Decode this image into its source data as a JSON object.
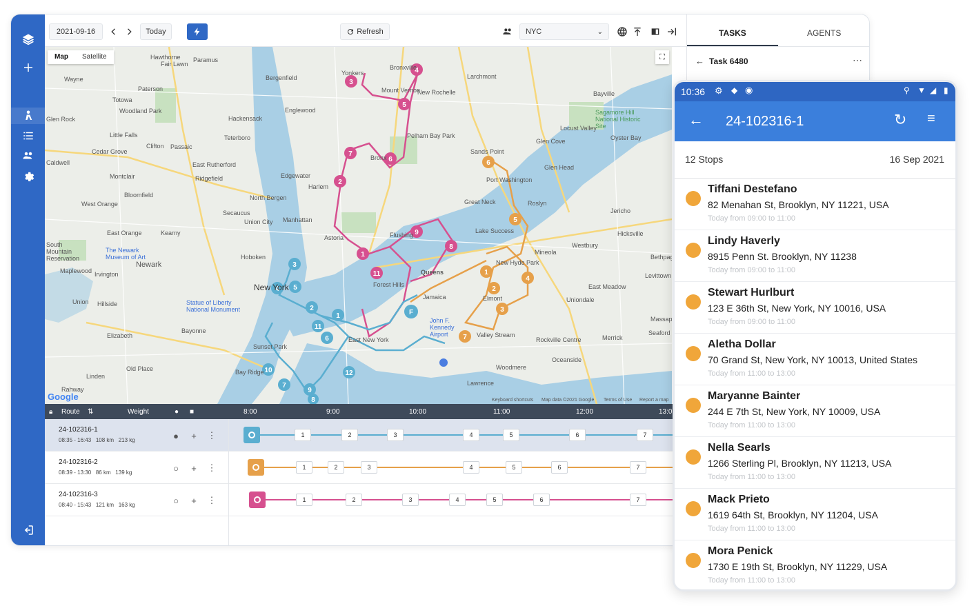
{
  "toolbar": {
    "date": "2021-09-16",
    "today_label": "Today",
    "refresh_label": "Refresh",
    "region": "NYC",
    "accent": "#2f68c5"
  },
  "map": {
    "map_label": "Map",
    "satellite_label": "Satellite",
    "labels": [
      "Paramus",
      "Hawthorne",
      "Fair Lawn",
      "Wayne",
      "Paterson",
      "Totowa",
      "Bergenfield",
      "Englewood",
      "Hackensack",
      "Teterboro",
      "Edgewater",
      "North Bergen",
      "Union City",
      "Montclair",
      "Bloomfield",
      "Clifton",
      "Passaic",
      "East Rutherford",
      "Secaucus",
      "West Orange",
      "East Orange",
      "Kearny",
      "Newark",
      "Hoboken",
      "New York",
      "Irvington",
      "Union",
      "Hillside",
      "Maplewood",
      "Elizabeth",
      "Bayonne",
      "Old Place",
      "Linden",
      "Rahway",
      "New Rochelle",
      "Larchmont",
      "Mount Vernon",
      "Bronxville",
      "Yonkers",
      "Pelham Bay Park",
      "Glen Cove",
      "Locust Valley",
      "Oyster Bay",
      "Bayville",
      "Sands Point",
      "Port Washington",
      "Roslyn",
      "Great Neck",
      "Jericho",
      "Hicksville",
      "Westbury",
      "Mineola",
      "New Hyde Park",
      "Elmont",
      "East Meadow",
      "Uniondale",
      "Merrick",
      "Valley Stream",
      "Oceanside",
      "Woodmere",
      "Lawrence",
      "Rockville Centre",
      "Levittown",
      "Bethpage",
      "Seaford",
      "Massapequa",
      "Queens",
      "Jamaica",
      "Forest Hills",
      "Astoria",
      "Flushing",
      "Manhattan",
      "John F. Kennedy Airport",
      "East New York",
      "Sunset Park",
      "Bay Ridge",
      "Statue of Liberty National Monument",
      "The Newark Museum of Art",
      "South Mountain Reservation",
      "Sagamore Hill National Historic Site",
      "Glen Head",
      "Lake Success",
      "Harlem",
      "Bronx",
      "Caldwell",
      "Cedar Grove",
      "Little Falls",
      "Woodland Park",
      "Glen Rock",
      "Ridgefield",
      "Keyboard shortcuts",
      "Map data ©2021 Google",
      "Terms of Use",
      "Report a map"
    ],
    "google": "Google"
  },
  "timeline": {
    "headers": {
      "route": "Route",
      "weight": "Weight"
    },
    "hours": [
      "8:00",
      "9:00",
      "10:00",
      "11:00",
      "12:00",
      "13:0"
    ],
    "routes": [
      {
        "name": "24-102316-1",
        "time": "08:35 - 16:43",
        "distance": "108 km",
        "weight": "213 kg",
        "color": "#5aaed0",
        "stops": [
          "1",
          "2",
          "3",
          "4",
          "5",
          "6",
          "7"
        ]
      },
      {
        "name": "24-102316-2",
        "time": "08:39 - 13:30",
        "distance": "86 km",
        "weight": "139 kg",
        "color": "#e6a04a",
        "stops": [
          "1",
          "2",
          "3",
          "4",
          "5",
          "6",
          "7"
        ]
      },
      {
        "name": "24-102316-3",
        "time": "08:40 - 15:43",
        "distance": "121 km",
        "weight": "163 kg",
        "color": "#d6508f",
        "stops": [
          "1",
          "2",
          "3",
          "4",
          "5",
          "6",
          "7"
        ]
      }
    ]
  },
  "panel": {
    "tab_tasks": "TASKS",
    "tab_agents": "AGENTS",
    "task_title": "Task 6480"
  },
  "phone": {
    "time": "10:36",
    "title": "24-102316-1",
    "stops_count": "12 Stops",
    "date": "16 Sep 2021",
    "stops": [
      {
        "name": "Tiffani Destefano",
        "address": "82 Menahan St, Brooklyn, NY 11221, USA",
        "window": "Today from 09:00 to 11:00"
      },
      {
        "name": "Lindy Haverly",
        "address": "8915 Penn St. Brooklyn, NY 11238",
        "window": "Today from 09:00 to 11:00"
      },
      {
        "name": "Stewart Hurlburt",
        "address": "123 E 36th St, New York, NY 10016, USA",
        "window": "Today from 09:00 to 11:00"
      },
      {
        "name": "Aletha Dollar",
        "address": "70 Grand St, New York, NY 10013, United States",
        "window": "Today from 11:00 to 13:00"
      },
      {
        "name": "Maryanne Bainter",
        "address": "244 E 7th St, New York, NY 10009, USA",
        "window": "Today from 11:00 to 13:00"
      },
      {
        "name": "Nella Searls",
        "address": "1266 Sterling Pl, Brooklyn, NY 11213, USA",
        "window": "Today from 11:00 to 13:00"
      },
      {
        "name": "Mack Prieto",
        "address": "1619 64th St, Brooklyn, NY 11204, USA",
        "window": "Today from 11:00 to 13:00"
      },
      {
        "name": "Mora Penick",
        "address": "1730 E 19th St, Brooklyn, NY 11229, USA",
        "window": "Today from 11:00 to 13:00"
      }
    ]
  }
}
